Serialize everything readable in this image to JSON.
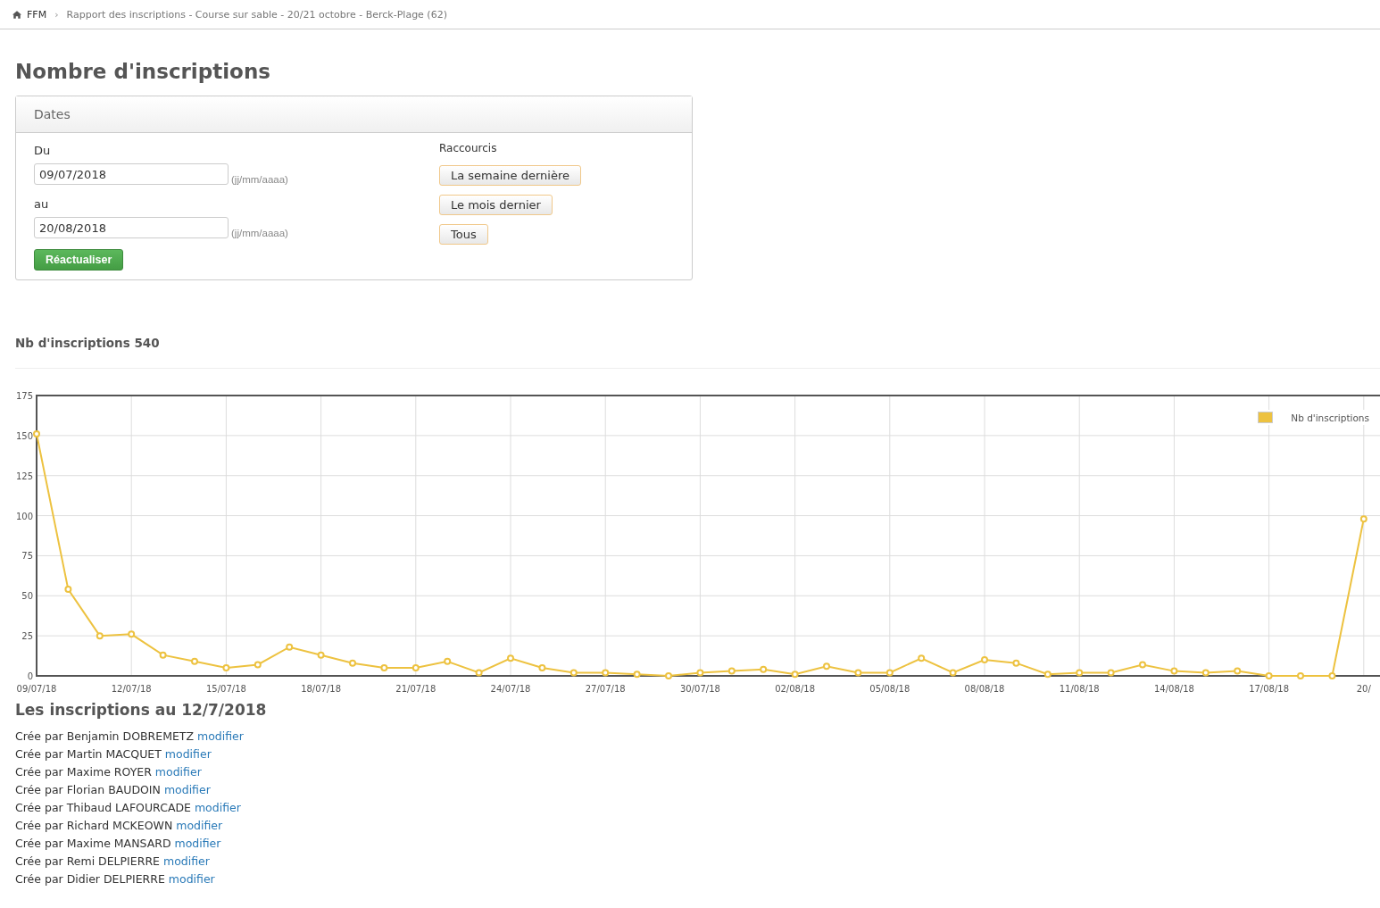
{
  "breadcrumb": {
    "home": "FFM",
    "separator": "›",
    "current": "Rapport des inscriptions - Course sur sable - 20/21 octobre - Berck-Plage (62)"
  },
  "title": "Nombre d'inscriptions",
  "dates_panel": {
    "heading": "Dates",
    "from": {
      "label": "Du",
      "value": "09/07/2018",
      "hint": "(jj/mm/aaaa)"
    },
    "to": {
      "label": "au",
      "value": "20/08/2018",
      "hint": "(jj/mm/aaaa)"
    },
    "refresh_button": "Réactualiser",
    "shortcuts": {
      "label": "Raccourcis",
      "buttons": [
        "La semaine dernière",
        "Le mois dernier",
        "Tous"
      ]
    }
  },
  "summary": "Nb d'inscriptions 540",
  "chart": {
    "chart_data": {
      "type": "line",
      "categories": [
        "09/07/18",
        null,
        null,
        "12/07/18",
        null,
        null,
        "15/07/18",
        null,
        null,
        "18/07/18",
        null,
        null,
        "21/07/18",
        null,
        null,
        "24/07/18",
        null,
        null,
        "27/07/18",
        null,
        null,
        "30/07/18",
        null,
        null,
        "02/08/18",
        null,
        null,
        "05/08/18",
        null,
        null,
        "08/08/18",
        null,
        null,
        "11/08/18",
        null,
        null,
        "14/08/18",
        null,
        null,
        "17/08/18",
        null,
        null,
        "20/"
      ],
      "series": [
        {
          "name": "Nb d'inscriptions",
          "color": "#edc240",
          "marker": "circle",
          "values": [
            151,
            54,
            25,
            26,
            13,
            9,
            5,
            7,
            18,
            13,
            8,
            5,
            5,
            9,
            2,
            11,
            5,
            2,
            2,
            1,
            0,
            2,
            3,
            4,
            1,
            6,
            2,
            2,
            11,
            2,
            10,
            8,
            1,
            2,
            2,
            7,
            3,
            2,
            3,
            0,
            0,
            0,
            98
          ]
        }
      ],
      "grid": true,
      "ylim": [
        0,
        175
      ],
      "yticks": [
        0,
        25,
        50,
        75,
        100,
        125,
        150,
        175
      ]
    }
  },
  "list": {
    "heading": "Les inscriptions au 12/7/2018",
    "items": [
      {
        "text": "Crée par Benjamin DOBREMETZ",
        "link": "modifier"
      },
      {
        "text": "Crée par Martin MACQUET",
        "link": "modifier"
      },
      {
        "text": "Crée par Maxime ROYER",
        "link": "modifier"
      },
      {
        "text": "Crée par Florian BAUDOIN",
        "link": "modifier"
      },
      {
        "text": "Crée par Thibaud LAFOURCADE",
        "link": "modifier"
      },
      {
        "text": "Crée par Richard MCKEOWN",
        "link": "modifier"
      },
      {
        "text": "Crée par Maxime MANSARD",
        "link": "modifier"
      },
      {
        "text": "Crée par Remi DELPIERRE",
        "link": "modifier"
      },
      {
        "text": "Crée par Didier DELPIERRE",
        "link": "modifier"
      }
    ]
  }
}
